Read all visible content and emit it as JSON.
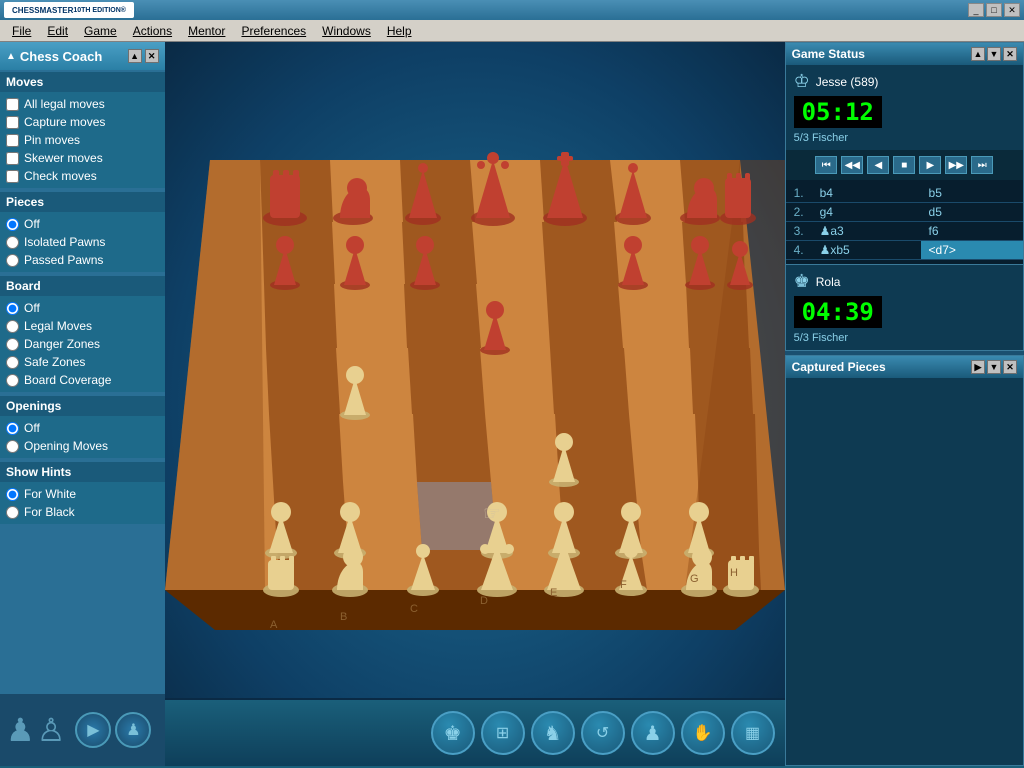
{
  "app": {
    "title": "Chessmaster 10th Edition",
    "title_bar": "Chessmaster 10th Edition"
  },
  "menu": {
    "items": [
      "File",
      "Edit",
      "Game",
      "Actions",
      "Mentor",
      "Preferences",
      "Windows",
      "Help"
    ]
  },
  "chess_coach": {
    "title": "Chess Coach",
    "minimize_label": "▲",
    "close_label": "✕",
    "sections": {
      "moves": {
        "header": "Moves",
        "items": [
          {
            "label": "All legal moves",
            "checked": false
          },
          {
            "label": "Capture moves",
            "checked": false
          },
          {
            "label": "Pin moves",
            "checked": false
          },
          {
            "label": "Skewer moves",
            "checked": false
          },
          {
            "label": "Check moves",
            "checked": false
          }
        ]
      },
      "pieces": {
        "header": "Pieces",
        "items": [
          {
            "label": "Off",
            "selected": true,
            "value": "off"
          },
          {
            "label": "Isolated Pawns",
            "selected": false,
            "value": "isolated"
          },
          {
            "label": "Passed Pawns",
            "selected": false,
            "value": "passed"
          }
        ]
      },
      "board": {
        "header": "Board",
        "items": [
          {
            "label": "Off",
            "selected": true,
            "value": "off"
          },
          {
            "label": "Legal Moves",
            "selected": false,
            "value": "legal"
          },
          {
            "label": "Danger Zones",
            "selected": false,
            "value": "danger"
          },
          {
            "label": "Safe Zones",
            "selected": false,
            "value": "safe"
          },
          {
            "label": "Board Coverage",
            "selected": false,
            "value": "coverage"
          }
        ]
      },
      "openings": {
        "header": "Openings",
        "items": [
          {
            "label": "Off",
            "selected": true,
            "value": "off"
          },
          {
            "label": "Opening Moves",
            "selected": false,
            "value": "opening"
          }
        ]
      },
      "show_hints": {
        "header": "Show Hints",
        "items": [
          {
            "label": "For White",
            "selected": true,
            "value": "white"
          },
          {
            "label": "For Black",
            "selected": false,
            "value": "black"
          }
        ]
      }
    }
  },
  "game_status": {
    "title": "Game Status",
    "player1": {
      "name": "Jesse (589)",
      "time": "05:12",
      "rating": "5/3 Fischer"
    },
    "player2": {
      "name": "Rola",
      "time": "04:39",
      "rating": "5/3 Fischer"
    },
    "moves": [
      {
        "number": "1.",
        "white": "b4",
        "black": "b5"
      },
      {
        "number": "2.",
        "white": "g4",
        "black": "d5"
      },
      {
        "number": "3.",
        "white": "♟a3",
        "black": "f6"
      },
      {
        "number": "4.",
        "white": "♟xb5",
        "black": "<d7>"
      }
    ]
  },
  "captured_pieces": {
    "title": "Captured Pieces"
  },
  "nav_buttons": {
    "first": "⏮",
    "prev_fast": "◀",
    "prev": "◀",
    "stop": "⏹",
    "next": "▶",
    "next_fast": "▶",
    "last": "⏭"
  },
  "toolbar_buttons": [
    {
      "name": "king-icon",
      "symbol": "♚"
    },
    {
      "name": "board-icon",
      "symbol": "⊞"
    },
    {
      "name": "knight-icon",
      "symbol": "♞"
    },
    {
      "name": "analysis-icon",
      "symbol": "↺"
    },
    {
      "name": "moves-icon",
      "symbol": "♟"
    },
    {
      "name": "hand-icon",
      "symbol": "✋"
    },
    {
      "name": "grid-icon",
      "symbol": "▦"
    }
  ],
  "bottom_left": {
    "piece1": "♟",
    "piece2": "♙"
  }
}
